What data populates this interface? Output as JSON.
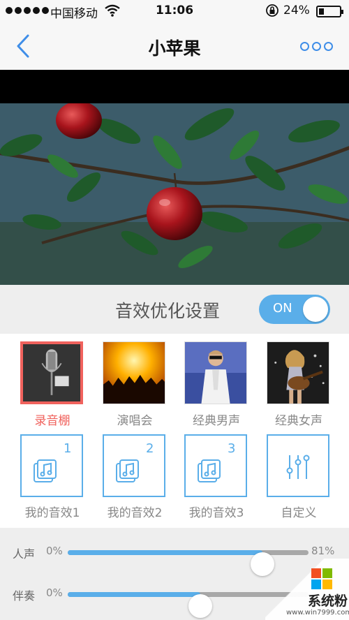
{
  "status_bar": {
    "carrier": "中国移动",
    "time": "11:06",
    "battery_percent": "24%",
    "battery_level": 0.24,
    "signal_icon": "signal-dots-icon",
    "wifi_icon": "wifi-icon",
    "lock_icon": "rotation-lock-icon"
  },
  "nav": {
    "title": "小苹果",
    "back_icon": "chevron-left-icon",
    "more_icon": "more-dots-icon"
  },
  "effect": {
    "label": "音效优化设置",
    "toggle_text": "ON",
    "toggle_on": true
  },
  "presets": [
    {
      "label": "录音棚",
      "selected": true,
      "icon": "studio-microphone-image"
    },
    {
      "label": "演唱会",
      "selected": false,
      "icon": "concert-image"
    },
    {
      "label": "经典男声",
      "selected": false,
      "icon": "male-singer-image"
    },
    {
      "label": "经典女声",
      "selected": false,
      "icon": "female-singer-image"
    }
  ],
  "custom_effects": [
    {
      "label": "我的音效1",
      "badge": "1",
      "icon": "music-note-stack-icon"
    },
    {
      "label": "我的音效2",
      "badge": "2",
      "icon": "music-note-stack-icon"
    },
    {
      "label": "我的音效3",
      "badge": "3",
      "icon": "music-note-stack-icon"
    },
    {
      "label": "自定义",
      "badge": "",
      "icon": "equalizer-icon"
    }
  ],
  "sliders": [
    {
      "name": "人声",
      "min_label": "0%",
      "max_label": "81%",
      "value": 0.81
    },
    {
      "name": "伴奏",
      "min_label": "0%",
      "max_label": "",
      "value": 0.55
    }
  ],
  "watermark": {
    "brand": "系统粉",
    "site": "www.win7999.com"
  },
  "colors": {
    "accent": "#5aaee9",
    "selected": "#f0625d",
    "nav_blue": "#3f8ee8"
  }
}
